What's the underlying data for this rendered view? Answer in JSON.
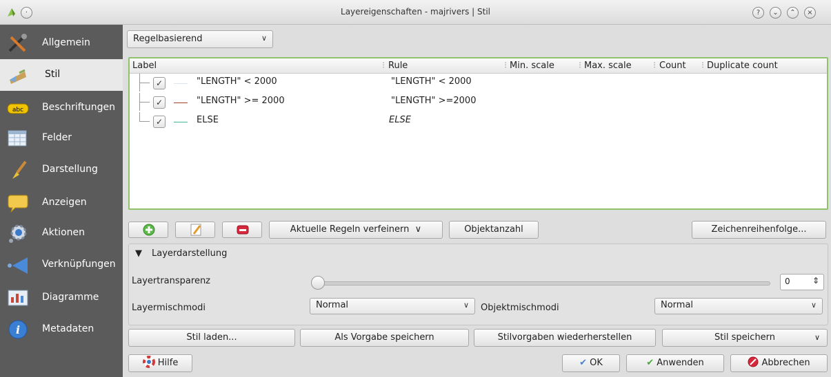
{
  "window": {
    "title": "Layereigenschaften - majrivers | Stil",
    "help_btn": "?",
    "min_btn": "⌄",
    "max_btn": "⌃",
    "close_btn": "×"
  },
  "sidebar": {
    "items": [
      {
        "label": "Allgemein",
        "icon": "tools-icon"
      },
      {
        "label": "Stil",
        "icon": "paint-icon"
      },
      {
        "label": "Beschriftungen",
        "icon": "abc-label-icon"
      },
      {
        "label": "Felder",
        "icon": "table-icon"
      },
      {
        "label": "Darstellung",
        "icon": "brush-icon"
      },
      {
        "label": "Anzeigen",
        "icon": "speech-bubble-icon"
      },
      {
        "label": "Aktionen",
        "icon": "gear-icon"
      },
      {
        "label": "Verknüpfungen",
        "icon": "join-icon"
      },
      {
        "label": "Diagramme",
        "icon": "diagram-icon"
      },
      {
        "label": "Metadaten",
        "icon": "info-icon"
      }
    ],
    "active_index": 1
  },
  "renderer": {
    "selected": "Regelbasierend"
  },
  "rules_table": {
    "headers": [
      "Label",
      "Rule",
      "Min. scale",
      "Max. scale",
      "Count",
      "Duplicate count"
    ],
    "rows": [
      {
        "label": "\"LENGTH\" < 2000",
        "rule": "\"LENGTH\" < 2000",
        "checked": true,
        "color": "#e6eefa"
      },
      {
        "label": "\"LENGTH\" >= 2000",
        "rule": "\"LENGTH\" >=2000",
        "checked": true,
        "color": "#a0432c"
      },
      {
        "label": "ELSE",
        "rule": "ELSE",
        "checked": true,
        "color": "#3cb79a"
      }
    ]
  },
  "rule_tools": {
    "refine_label": "Aktuelle Regeln verfeinern",
    "count_label": "Objektanzahl",
    "order_label": "Zeichenreihenfolge..."
  },
  "layer_rendering": {
    "title": "Layerdarstellung",
    "transparency_label": "Layertransparenz",
    "transparency_value": "0",
    "blend_label": "Layermischmodi",
    "blend_value": "Normal",
    "feature_blend_label": "Objektmischmodi",
    "feature_blend_value": "Normal"
  },
  "style_buttons": {
    "load": "Stil laden...",
    "save_default": "Als Vorgabe speichern",
    "restore_default": "Stilvorgaben wiederherstellen",
    "save": "Stil speichern"
  },
  "footer": {
    "help": "Hilfe",
    "ok": "OK",
    "apply": "Anwenden",
    "cancel": "Abbrechen"
  },
  "colors": {
    "sidebar_bg": "#5b5b5b",
    "focus_border": "#8fc26a"
  }
}
